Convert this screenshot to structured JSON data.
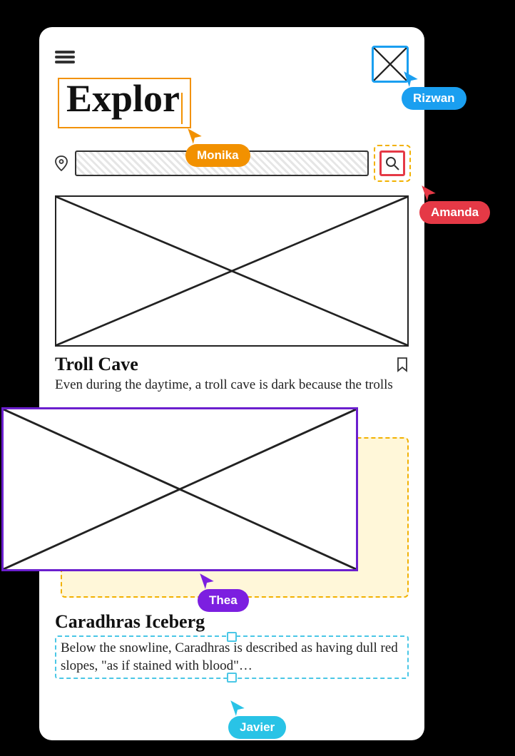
{
  "collaborators": {
    "rizwan": "Rizwan",
    "monika": "Monika",
    "amanda": "Amanda",
    "thea": "Thea",
    "javier": "Javier"
  },
  "title_typing": "Explor",
  "card1": {
    "title": "Troll Cave",
    "desc": "Even during the daytime, a troll cave is dark because the trolls"
  },
  "card2": {
    "title": "Caradhras Iceberg",
    "desc": "Below the snowline, Caradhras is described as having dull red slopes, \"as if stained with blood\"…"
  }
}
